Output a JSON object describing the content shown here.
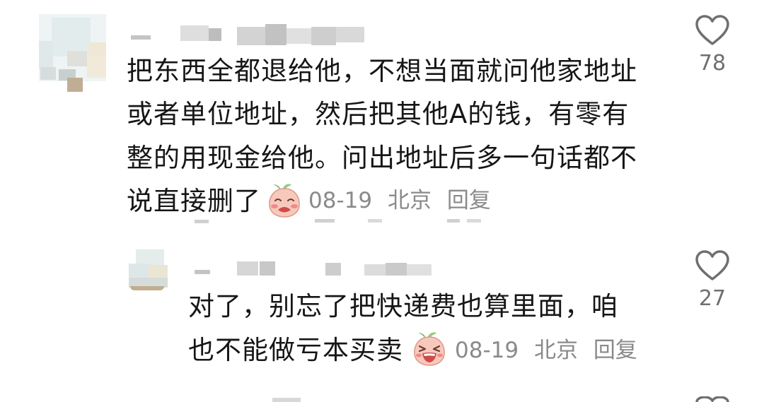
{
  "comments": [
    {
      "text_lines": [
        "把东西全都退给他，不想当面就问他家地址",
        "或者单位地址，然后把其他A的钱，有零有",
        "整的用现金给他。问出地址后多一句话都不",
        "说直接删了"
      ],
      "emoji": "crying-peach-emoji",
      "date": "08-19",
      "location": "北京",
      "reply_label": "回复",
      "like_count": "78"
    },
    {
      "text_lines": [
        "对了，别忘了把快递费也算里面，咱",
        "也不能做亏本买卖"
      ],
      "emoji": "laughing-peach-emoji",
      "date": "08-19",
      "location": "北京",
      "reply_label": "回复",
      "like_count": "27"
    }
  ],
  "colors": {
    "text": "#161616",
    "meta": "#8a8a8a",
    "icon": "#6f6f6f"
  }
}
